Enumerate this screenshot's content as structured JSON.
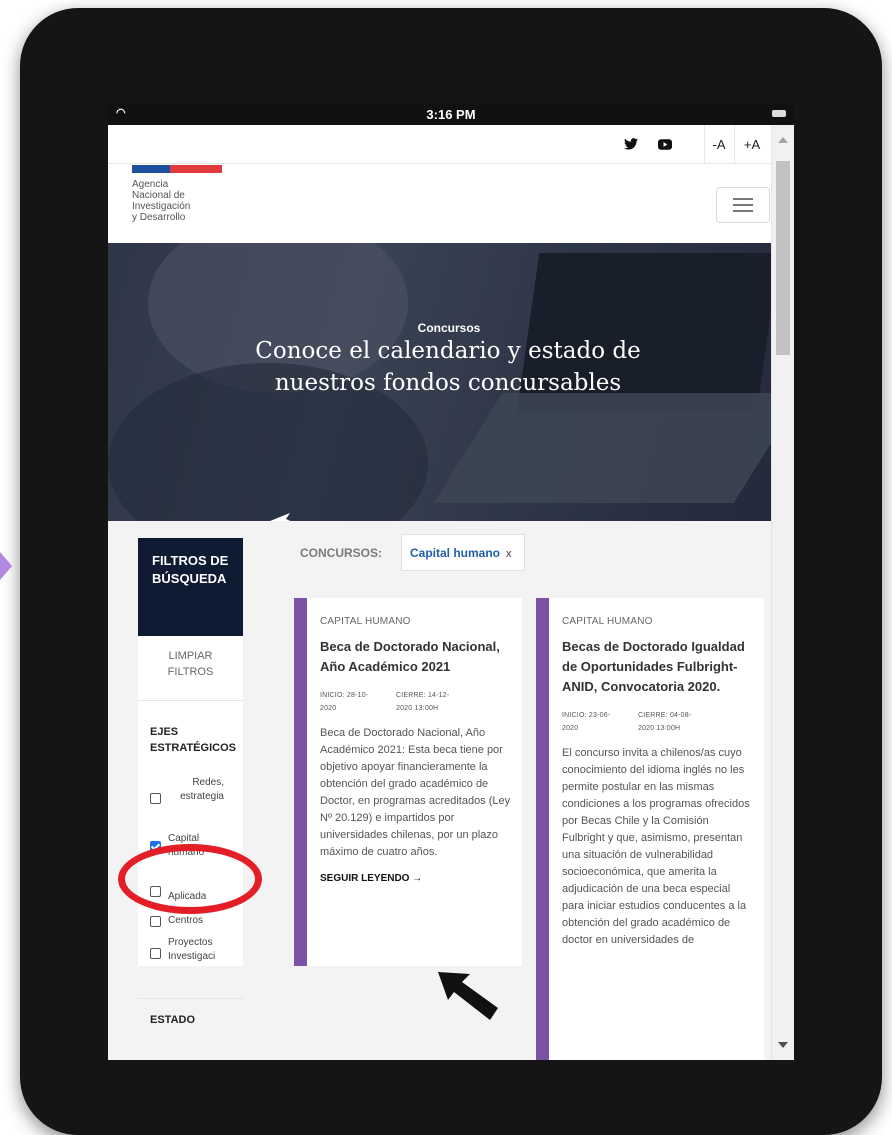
{
  "statusbar": {
    "time": "3:16 PM"
  },
  "topbar": {
    "twitter": "twitter-icon",
    "youtube": "youtube-icon",
    "font_minus": "-A",
    "font_plus": "+A"
  },
  "logo": {
    "lines": [
      "Agencia",
      "Nacional de",
      "Investigación",
      "y Desarrollo"
    ]
  },
  "hero": {
    "kicker": "Concursos",
    "title": "Conoce el calendario y estado de nuestros fondos concursables"
  },
  "sidebar": {
    "heading": "FILTROS DE BÚSQUEDA",
    "clear": "LIMPIAR FILTROS",
    "section_ejes": "EJES ESTRATÉGICOS",
    "filters": [
      {
        "label": "Redes, estrategia",
        "checked": false
      },
      {
        "label": "Capital humano",
        "checked": true
      },
      {
        "label": "Aplicada",
        "checked": false
      },
      {
        "label": "Centros",
        "checked": false
      },
      {
        "label": "Proyectos Investigaci",
        "checked": false
      }
    ],
    "section_estado": "ESTADO"
  },
  "concursos": {
    "label": "CONCURSOS:",
    "active_tag": "Capital humano",
    "remove": "x"
  },
  "cards": [
    {
      "category": "CAPITAL HUMANO",
      "title": "Beca de Doctorado Nacional, Año Académico 2021",
      "inicio": "INICIO: 28-10-2020",
      "cierre": "CIERRE: 14-12-2020 13:00H",
      "description": "Beca de Doctorado Nacional, Año Académico 2021: Esta beca tiene por objetivo apoyar financieramente la obtención del grado académico de Doctor, en programas acreditados (Ley Nº 20.129) e impartidos por universidades chilenas, por un plazo máximo de cuatro años.",
      "more": "SEGUIR LEYENDO →"
    },
    {
      "category": "CAPITAL HUMANO",
      "title": "Becas de Doctorado Igualdad de Oportunidades Fulbright-ANID, Convocatoria 2020.",
      "inicio": "INICIO: 23-06-2020",
      "cierre": "CIERRE: 04-08-2020 13:00H",
      "description": "El concurso invita a chilenos/as cuyo conocimiento del idioma inglés no les permite postular en las mismas condiciones a los programas ofrecidos por Becas Chile y la Comisión Fulbright y que, asimismo, presentan una situación de vulnerabilidad socioeconómica, que amerita la adjudicación de una beca especial para iniciar estudios conducentes a la obtención del grado académico de doctor en universidades de"
    }
  ]
}
